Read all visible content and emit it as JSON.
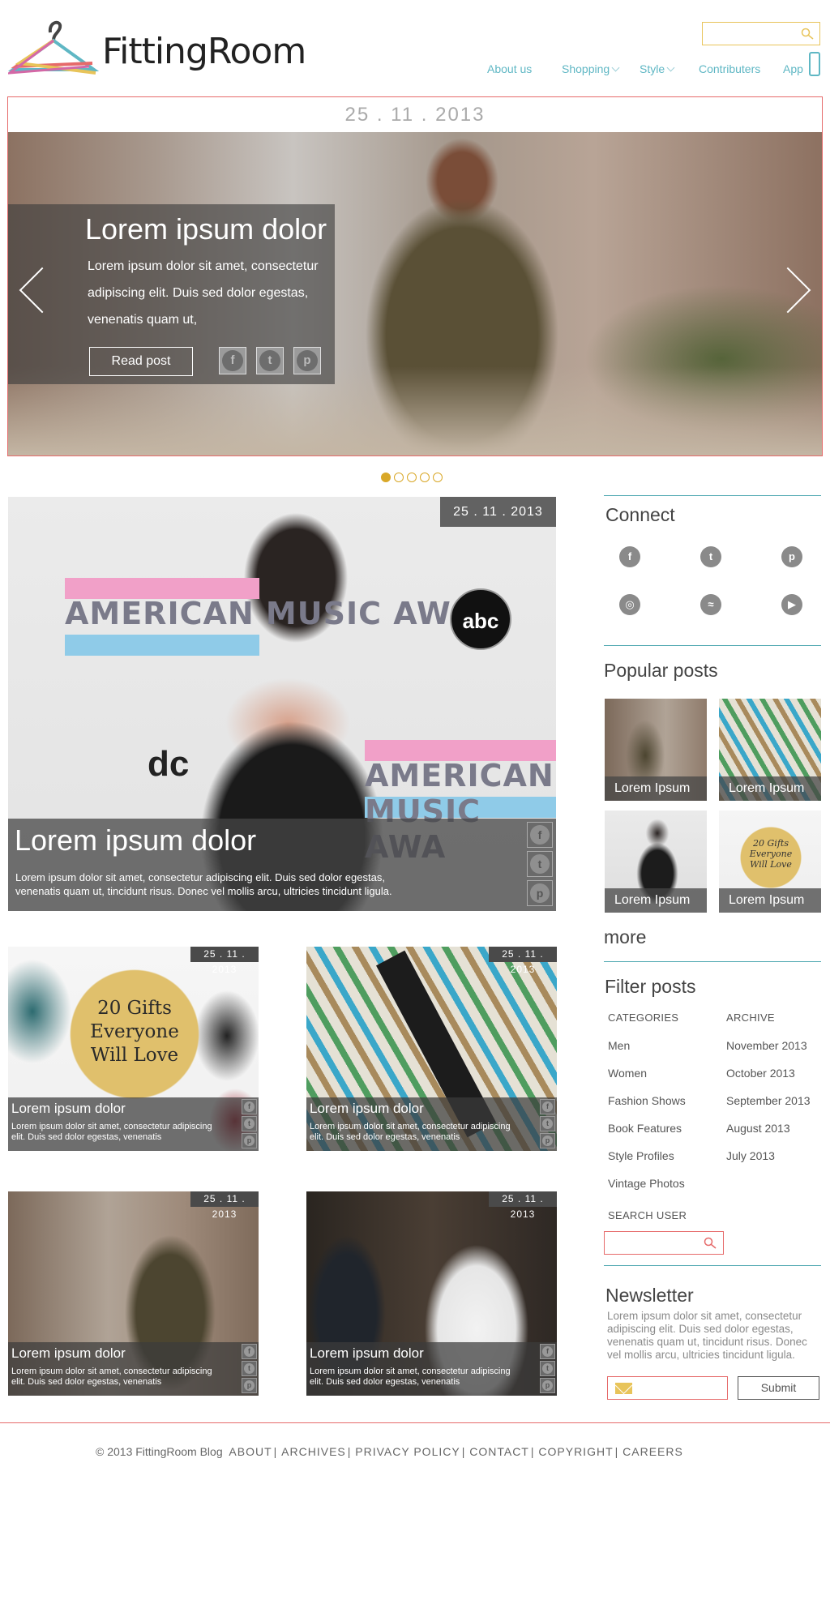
{
  "header": {
    "logo_text": "FittingRoom",
    "search_placeholder": "",
    "nav": [
      {
        "label": "About us"
      },
      {
        "label": "Shopping"
      },
      {
        "label": "Style"
      },
      {
        "label": "Contributers"
      },
      {
        "label": "App"
      }
    ],
    "icons": {
      "search": "search-icon",
      "app": "phone-icon"
    }
  },
  "hero": {
    "date": "25 . 11 . 2013",
    "title": "Lorem ipsum dolor",
    "text": "Lorem ipsum dolor sit amet, consectetur adipiscing elit. Duis sed dolor egestas, venenatis quam ut,",
    "button": "Read post",
    "social": [
      "f",
      "t",
      "p"
    ],
    "slide_count": 5,
    "active_slide": 1
  },
  "featured": {
    "date": "25 . 11 . 2013",
    "title": "Lorem ipsum dolor",
    "text": "Lorem ipsum dolor sit amet, consectetur adipiscing elit. Duis sed dolor egestas, venenatis quam ut, tincidunt risus. Donec vel mollis arcu, ultricies tincidunt ligula.",
    "image_text": {
      "banner1": "AMERICAN MUSIC AW",
      "banner2": "AMERICAN MUSIC AWA",
      "abc": "abc",
      "dc": "dc"
    }
  },
  "posts": [
    {
      "date": "25 . 11 . 2013",
      "title": "Lorem ipsum dolor",
      "text": "Lorem ipsum dolor sit amet, consectetur adipiscing elit. Duis sed dolor egestas, venenatis",
      "image_text": "20 Gifts Everyone Will Love"
    },
    {
      "date": "25 . 11 . 2013",
      "title": "Lorem ipsum dolor",
      "text": "Lorem ipsum dolor sit amet, consectetur adipiscing elit. Duis sed dolor egestas, venenatis"
    },
    {
      "date": "25 . 11 . 2013",
      "title": "Lorem ipsum dolor",
      "text": "Lorem ipsum dolor sit amet, consectetur adipiscing elit. Duis sed dolor egestas, venenatis"
    },
    {
      "date": "25 . 11 . 2013",
      "title": "Lorem ipsum dolor",
      "text": "Lorem ipsum dolor sit amet, consectetur adipiscing elit. Duis sed dolor egestas, venenatis"
    }
  ],
  "sidebar": {
    "connect_heading": "Connect",
    "connect_icons": [
      {
        "name": "facebook-icon",
        "glyph": "f"
      },
      {
        "name": "twitter-icon",
        "glyph": "t"
      },
      {
        "name": "pinterest-icon",
        "glyph": "p"
      },
      {
        "name": "instagram-icon",
        "glyph": "◎"
      },
      {
        "name": "rss-icon",
        "glyph": "≈"
      },
      {
        "name": "youtube-icon",
        "glyph": "▶"
      }
    ],
    "popular_heading": "Popular posts",
    "popular": [
      {
        "label": "Lorem Ipsum"
      },
      {
        "label": "Lorem Ipsum"
      },
      {
        "label": "Lorem Ipsum"
      },
      {
        "label": "Lorem Ipsum",
        "image_text": "20 Gifts Everyone Will Love"
      }
    ],
    "more": "more",
    "filter_heading": "Filter posts",
    "categories_header": "CATEGORIES",
    "archive_header": "ARCHIVE",
    "categories": [
      "Men",
      "Women",
      "Fashion Shows",
      "Book Features",
      "Style Profiles",
      "Vintage Photos"
    ],
    "archive": [
      "November 2013",
      "October 2013",
      "September 2013",
      "August 2013",
      "July 2013"
    ],
    "search_user_header": "SEARCH USER",
    "newsletter_heading": "Newsletter",
    "newsletter_text": "Lorem ipsum dolor sit amet, consectetur adipiscing elit. Duis sed dolor egestas, venenatis quam ut, tincidunt risus. Donec vel mollis arcu, ultricies tincidunt ligula.",
    "submit": "Submit"
  },
  "footer": {
    "copyright": "© 2013 FittingRoom Blog",
    "links": [
      "ABOUT",
      "ARCHIVES",
      "PRIVACY POLICY",
      "CONTACT",
      "COPYRIGHT",
      "CAREERS"
    ]
  },
  "colors": {
    "accent_teal": "#5fb7c4",
    "accent_red": "#e66a6a",
    "accent_gold": "#d9a828"
  }
}
